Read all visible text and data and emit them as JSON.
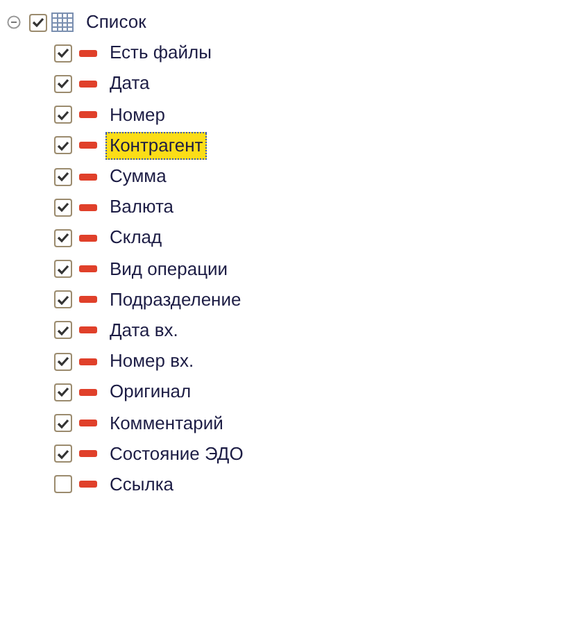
{
  "tree": {
    "label": "Список",
    "expanded": true,
    "checked": true,
    "selected": false,
    "children": [
      {
        "label": "Есть файлы",
        "checked": true,
        "selected": false
      },
      {
        "label": "Дата",
        "checked": true,
        "selected": false
      },
      {
        "label": "Номер",
        "checked": true,
        "selected": false
      },
      {
        "label": "Контрагент",
        "checked": true,
        "selected": true
      },
      {
        "label": "Сумма",
        "checked": true,
        "selected": false
      },
      {
        "label": "Валюта",
        "checked": true,
        "selected": false
      },
      {
        "label": "Склад",
        "checked": true,
        "selected": false
      },
      {
        "label": "Вид операции",
        "checked": true,
        "selected": false
      },
      {
        "label": "Подразделение",
        "checked": true,
        "selected": false
      },
      {
        "label": "Дата вх.",
        "checked": true,
        "selected": false
      },
      {
        "label": "Номер вх.",
        "checked": true,
        "selected": false
      },
      {
        "label": "Оригинал",
        "checked": true,
        "selected": false
      },
      {
        "label": "Комментарий",
        "checked": true,
        "selected": false
      },
      {
        "label": "Состояние ЭДО",
        "checked": true,
        "selected": false
      },
      {
        "label": "Ссылка",
        "checked": false,
        "selected": false
      }
    ]
  }
}
